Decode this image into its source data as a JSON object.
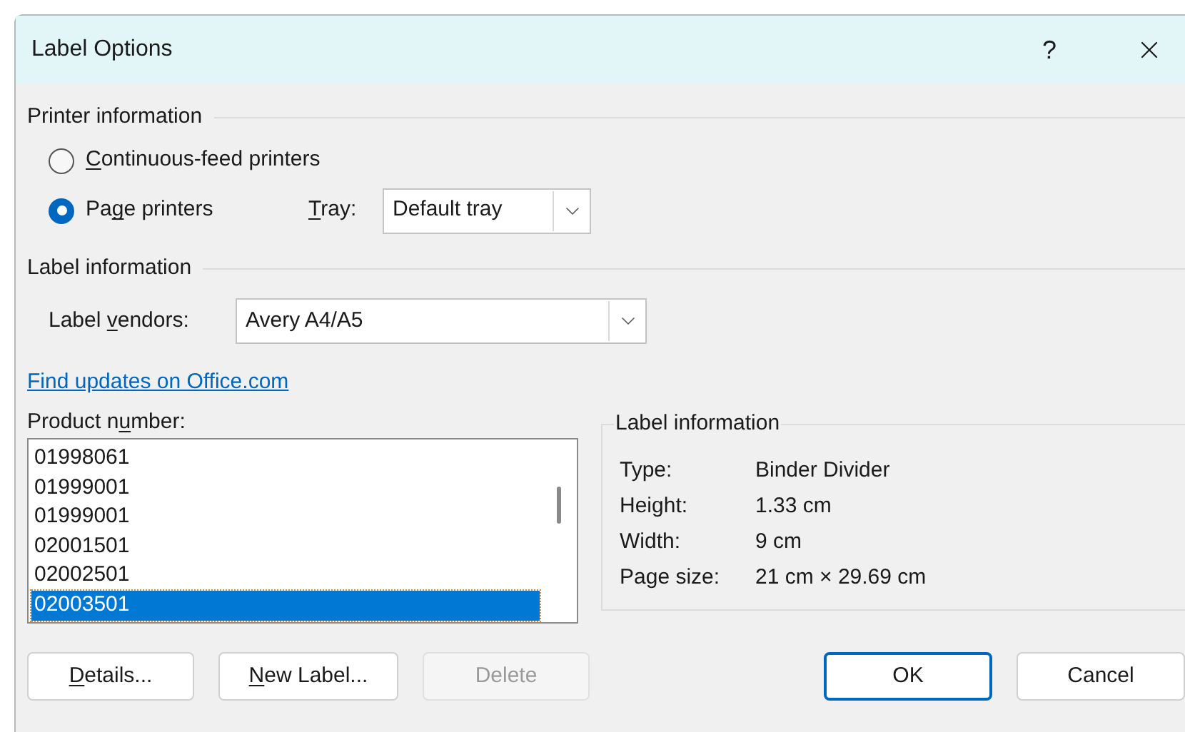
{
  "window": {
    "title": "Label Options",
    "help": "?"
  },
  "printer_information": {
    "title": "Printer information",
    "options": [
      {
        "label": [
          {
            "text": "C",
            "underline": true
          },
          {
            "text": "ontinuous-feed printers",
            "underline": false
          }
        ],
        "selected": false
      },
      {
        "label": [
          {
            "text": "Pa",
            "underline": false
          },
          {
            "text": "g",
            "underline": true
          },
          {
            "text": "e printers",
            "underline": false
          }
        ],
        "selected": true
      }
    ],
    "tray": {
      "label": [
        {
          "text": "T",
          "underline": true
        },
        {
          "text": "ray:",
          "underline": false
        }
      ],
      "value": "Default tray"
    }
  },
  "label_information": {
    "title": "Label information",
    "vendors": {
      "label": [
        {
          "text": "Label ",
          "underline": false
        },
        {
          "text": "v",
          "underline": true
        },
        {
          "text": "endors:",
          "underline": false
        }
      ],
      "value": "Avery A4/A5"
    }
  },
  "link": "Find updates on Office.com",
  "product_number": {
    "label": [
      {
        "text": "Product n",
        "underline": false
      },
      {
        "text": "u",
        "underline": true
      },
      {
        "text": "mber:",
        "underline": false
      }
    ],
    "items": [
      {
        "text": "01998061",
        "selected": false
      },
      {
        "text": "01999001",
        "selected": false
      },
      {
        "text": "01999001",
        "selected": false
      },
      {
        "text": "02001501",
        "selected": false
      },
      {
        "text": "02002501",
        "selected": false
      },
      {
        "text": "02003501",
        "selected": true
      }
    ]
  },
  "details": {
    "title": "Label information",
    "rows": [
      {
        "name": "Type:",
        "value": "Binder Divider"
      },
      {
        "name": "Height:",
        "value": "1.33 cm"
      },
      {
        "name": "Width:",
        "value": "9 cm"
      },
      {
        "name": "Page size:",
        "value": "21 cm × 29.69 cm"
      }
    ]
  },
  "buttons": [
    {
      "label": [
        {
          "text": "D",
          "underline": true
        },
        {
          "text": "etails...",
          "underline": false
        }
      ],
      "disabled": false,
      "default": false
    },
    {
      "label": [
        {
          "text": "N",
          "underline": true
        },
        {
          "text": "ew Label...",
          "underline": false
        }
      ],
      "disabled": false,
      "default": false
    },
    {
      "label": [
        {
          "text": "Delete",
          "underline": false
        }
      ],
      "disabled": true,
      "default": false
    },
    {
      "label": [
        {
          "text": "OK",
          "underline": false
        }
      ],
      "disabled": false,
      "default": true
    },
    {
      "label": [
        {
          "text": "Cancel",
          "underline": false
        }
      ],
      "disabled": false,
      "default": false
    }
  ]
}
